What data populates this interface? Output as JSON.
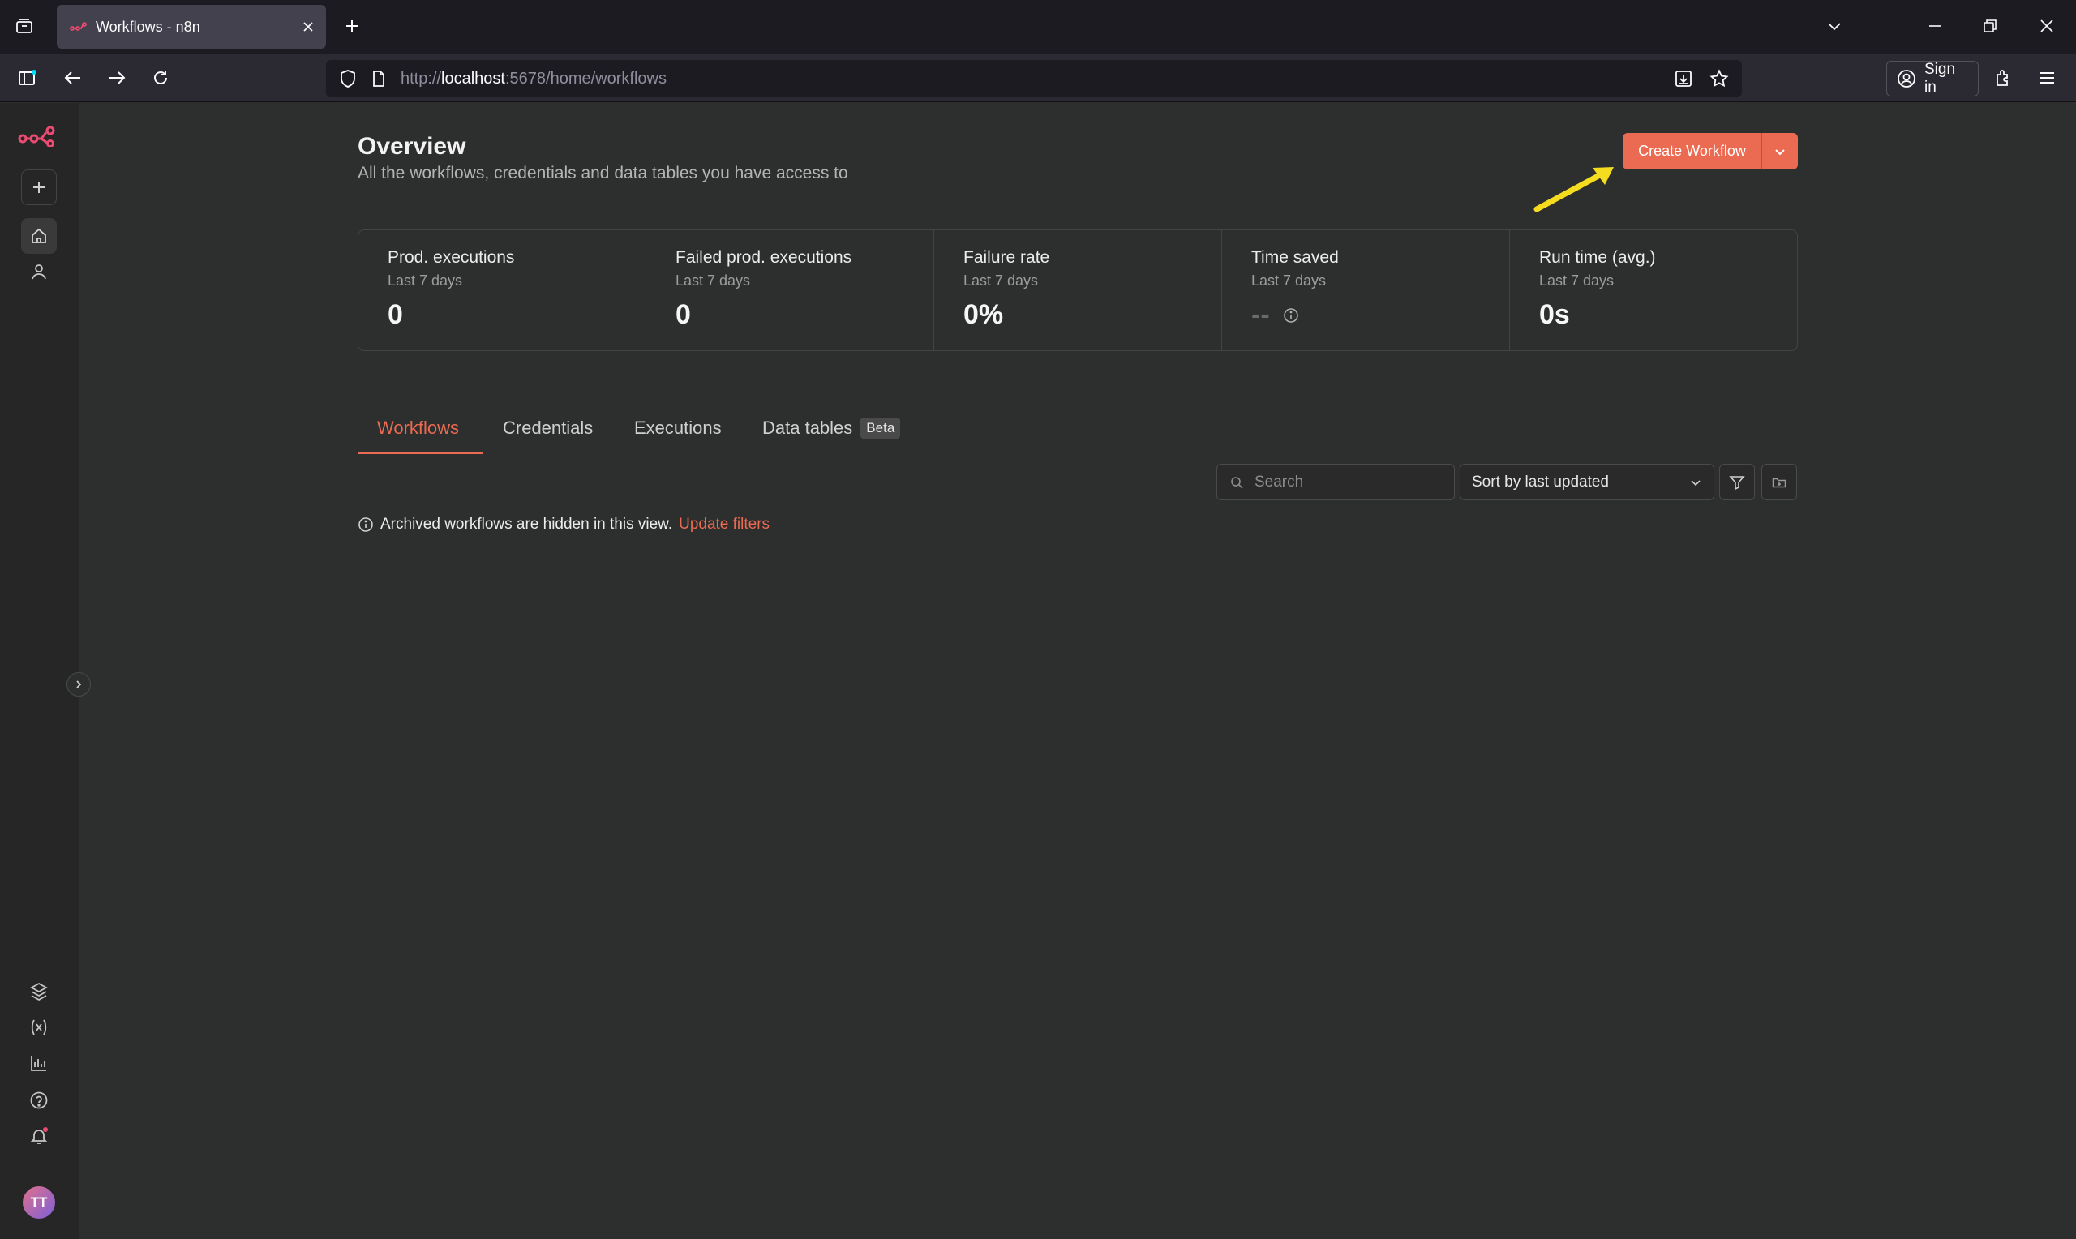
{
  "browser": {
    "tab_title": "Workflows - n8n",
    "url_prefix": "http://",
    "url_host": "localhost",
    "url_rest": ":5678/home/workflows",
    "signin_label": "Sign in"
  },
  "header": {
    "title": "Overview",
    "subtitle": "All the workflows, credentials and data tables you have access to",
    "create_label": "Create Workflow"
  },
  "stats": [
    {
      "label": "Prod. executions",
      "period": "Last 7 days",
      "value": "0"
    },
    {
      "label": "Failed prod. executions",
      "period": "Last 7 days",
      "value": "0"
    },
    {
      "label": "Failure rate",
      "period": "Last 7 days",
      "value": "0%"
    },
    {
      "label": "Time saved",
      "period": "Last 7 days",
      "value": "--"
    },
    {
      "label": "Run time (avg.)",
      "period": "Last 7 days",
      "value": "0s"
    }
  ],
  "tabs": [
    {
      "label": "Workflows",
      "active": true
    },
    {
      "label": "Credentials"
    },
    {
      "label": "Executions"
    },
    {
      "label": "Data tables",
      "badge": "Beta"
    }
  ],
  "toolbar": {
    "search_placeholder": "Search",
    "sort_label": "Sort by last updated"
  },
  "notice": {
    "text": "Archived workflows are hidden in this view.",
    "link": "Update filters"
  },
  "user": {
    "initials": "TT"
  },
  "colors": {
    "accent": "#ea6a52",
    "annotation_arrow": "#f5dc1e"
  },
  "icons": [
    "tab-list-icon",
    "n8n-logo-icon",
    "plus-icon",
    "home-icon",
    "user-icon",
    "templates-icon",
    "variables-icon",
    "insights-icon",
    "help-icon",
    "bell-icon",
    "shield-icon",
    "page-icon",
    "download-icon",
    "star-icon",
    "extensions-icon",
    "menu-icon",
    "filter-icon",
    "folder-icon",
    "info-icon",
    "search-icon",
    "chevron-down-icon"
  ]
}
